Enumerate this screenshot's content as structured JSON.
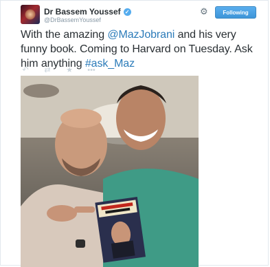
{
  "author": {
    "display_name": "Dr Bassem Youssef",
    "handle": "@DrBassemYoussef",
    "verified_mark": "✓"
  },
  "follow_button": {
    "label": "Following",
    "color": "#55acee"
  },
  "tweet": {
    "segments": [
      {
        "text": "With the amazing ",
        "type": "text"
      },
      {
        "text": "@MazJobrani",
        "type": "mention"
      },
      {
        "text": "  and his very funny book. Coming to Harvard on Tuesday. Ask him anything ",
        "type": "text"
      },
      {
        "text": "#ask_Maz",
        "type": "hashtag"
      }
    ]
  },
  "icons": {
    "settings": "gear-icon",
    "reply": "reply-icon",
    "retweet": "retweet-icon",
    "favorite": "star-icon",
    "more": "more-icon"
  },
  "colors": {
    "link": "#2b7bb9",
    "muted": "#8899a6",
    "action_icon": "#ccd6dd"
  }
}
